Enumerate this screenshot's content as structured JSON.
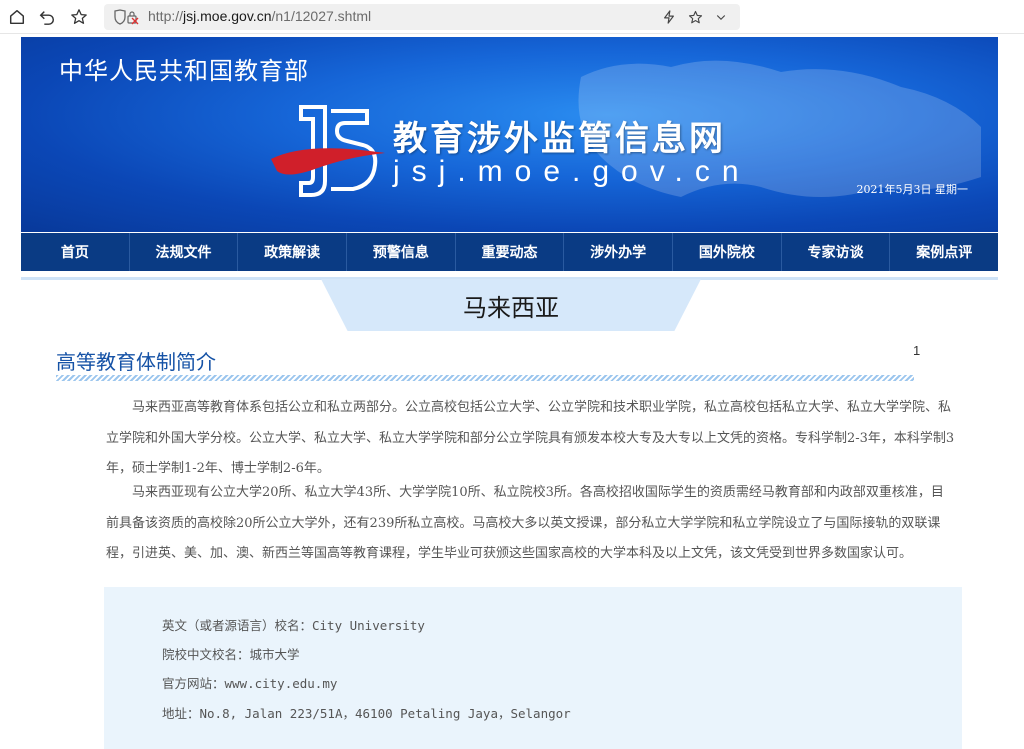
{
  "browser": {
    "url_prefix": "http://",
    "url_host": "jsj.moe.gov.cn",
    "url_path": "/n1/12027.shtml",
    "icons": [
      "home-icon",
      "back-icon",
      "favorite-icon",
      "security-icon",
      "lightning-icon",
      "star-icon",
      "chevron-down-icon"
    ]
  },
  "banner": {
    "ministry": "中华人民共和国教育部",
    "site_name": "教育涉外监管信息网",
    "site_domain": "jsj.moe.gov.cn",
    "date": "2021年5月3日  星期一"
  },
  "nav": {
    "items": [
      {
        "label": "首页"
      },
      {
        "label": "法规文件"
      },
      {
        "label": "政策解读"
      },
      {
        "label": "预警信息"
      },
      {
        "label": "重要动态"
      },
      {
        "label": "涉外办学"
      },
      {
        "label": "国外院校"
      },
      {
        "label": "专家访谈"
      },
      {
        "label": "案例点评"
      }
    ]
  },
  "country": "马来西亚",
  "article": {
    "title": "高等教育体制简介",
    "page_number": "1",
    "paragraph1": "马来西亚高等教育体系包括公立和私立两部分。公立高校包括公立大学、公立学院和技术职业学院，私立高校包括私立大学、私立大学学院、私立学院和外国大学分校。公立大学、私立大学、私立大学学院和部分公立学院具有颁发本校大专及大专以上文凭的资格。专科学制2-3年，本科学制3年，硕士学制1-2年、博士学制2-6年。",
    "paragraph2": "马来西亚现有公立大学20所、私立大学43所、大学学院10所、私立院校3所。各高校招收国际学生的资质需经马教育部和内政部双重核准，目前具备该资质的高校除20所公立大学外，还有239所私立高校。马高校大多以英文授课，部分私立大学学院和私立学院设立了与国际接轨的双联课程，引进英、美、加、澳、新西兰等国高等教育课程，学生毕业可获颁这些国家高校的大学本科及以上文凭，该文凭受到世界多数国家认可。"
  },
  "school": {
    "english_name": "英文（或者源语言）校名：City University",
    "chinese_name": "院校中文校名：城市大学",
    "website": "官方网站：www.city.edu.my",
    "address": "地址：No.8, Jalan 223/51A，46100 Petaling Jaya，Selangor"
  },
  "colors": {
    "nav_bg": "#0a3b84",
    "banner_blue": "#1666d8",
    "title_blue": "#1552a6",
    "info_bg": "#eaf4fc"
  }
}
